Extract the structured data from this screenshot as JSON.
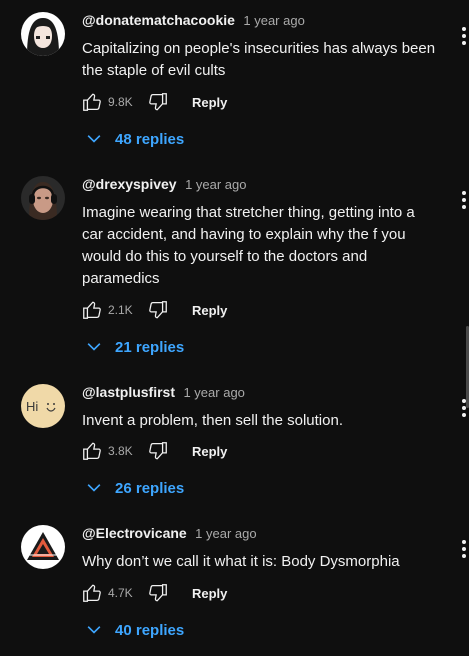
{
  "comments": [
    {
      "author": "@donatematchacookie",
      "time": "1 year ago",
      "lines": [
        "Capitalizing on people's insecurities has always been",
        "the staple of evil cults"
      ],
      "likes": "9.8K",
      "reply_label": "Reply",
      "replies_label": "48 replies",
      "avatar_icon": "anime-girl-avatar-icon"
    },
    {
      "author": "@drexyspivey",
      "time": "1 year ago",
      "lines": [
        "Imagine wearing that stretcher thing, getting into a",
        "car accident, and having to explain why the f you",
        "would do this to yourself to the doctors and",
        "paramedics"
      ],
      "likes": "2.1K",
      "reply_label": "Reply",
      "replies_label": "21 replies",
      "avatar_icon": "headphones-person-avatar-icon"
    },
    {
      "author": "@lastplusfirst",
      "time": "1 year ago",
      "lines": [
        "Invent a problem, then sell the solution."
      ],
      "likes": "3.8K",
      "reply_label": "Reply",
      "replies_label": "26 replies",
      "avatar_icon": "hi-smiley-avatar-icon",
      "avatar_text": "Hi"
    },
    {
      "author": "@Electrovicane",
      "time": "1 year ago",
      "lines": [
        "Why don’t we call it what it is: Body Dysmorphia"
      ],
      "likes": "4.7K",
      "reply_label": "Reply",
      "replies_label": "40 replies",
      "avatar_icon": "triangle-logo-avatar-icon"
    }
  ],
  "colors": {
    "background": "#0f0f0f",
    "text": "#f1f1f1",
    "muted": "#aaaaaa",
    "link": "#3ea6ff"
  }
}
